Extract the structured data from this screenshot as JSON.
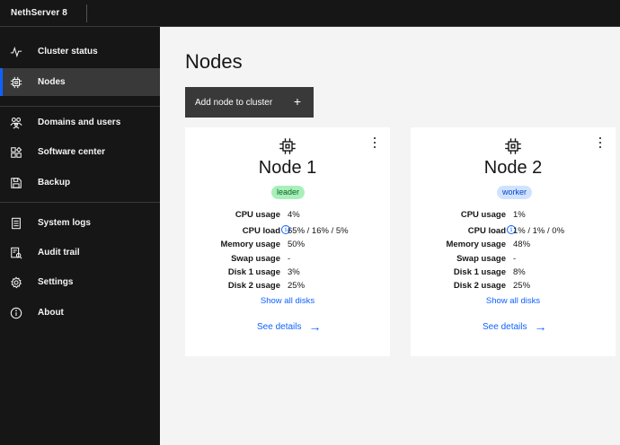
{
  "header": {
    "title": "NethServer 8"
  },
  "sidebar": {
    "items": [
      {
        "label": "Cluster status",
        "icon": "activity-icon"
      },
      {
        "label": "Nodes",
        "icon": "chip-icon",
        "active": true
      },
      {
        "label": "Domains and users",
        "icon": "users-icon"
      },
      {
        "label": "Software center",
        "icon": "apps-icon"
      },
      {
        "label": "Backup",
        "icon": "save-icon"
      },
      {
        "label": "System logs",
        "icon": "logs-icon"
      },
      {
        "label": "Audit trail",
        "icon": "audit-icon"
      },
      {
        "label": "Settings",
        "icon": "settings-icon"
      },
      {
        "label": "About",
        "icon": "info-icon"
      }
    ]
  },
  "main": {
    "title": "Nodes",
    "add_button": {
      "label": "Add node to cluster",
      "icon": "+"
    },
    "stat_labels": [
      "CPU usage",
      "CPU load",
      "Memory usage",
      "Swap usage",
      "Disk 1 usage",
      "Disk 2 usage"
    ],
    "nodes": [
      {
        "name": "Node 1",
        "role": "leader",
        "cpu_usage": "4%",
        "cpu_load": "65% / 16% / 5%",
        "memory_usage": "50%",
        "swap_usage": "-",
        "disk1_usage": "3%",
        "disk2_usage": "25%",
        "show_disks": "Show all disks",
        "see_details": "See details"
      },
      {
        "name": "Node 2",
        "role": "worker",
        "cpu_usage": "1%",
        "cpu_load": "1% / 1% / 0%",
        "memory_usage": "48%",
        "swap_usage": "-",
        "disk1_usage": "8%",
        "disk2_usage": "25%",
        "show_disks": "Show all disks",
        "see_details": "See details"
      }
    ]
  },
  "colors": {
    "sidebar_bg": "#161616",
    "active_item_bg": "#393939",
    "link": "#0f62fe",
    "leader_badge_bg": "#a7f0ba",
    "worker_badge_bg": "#d0e2ff"
  }
}
